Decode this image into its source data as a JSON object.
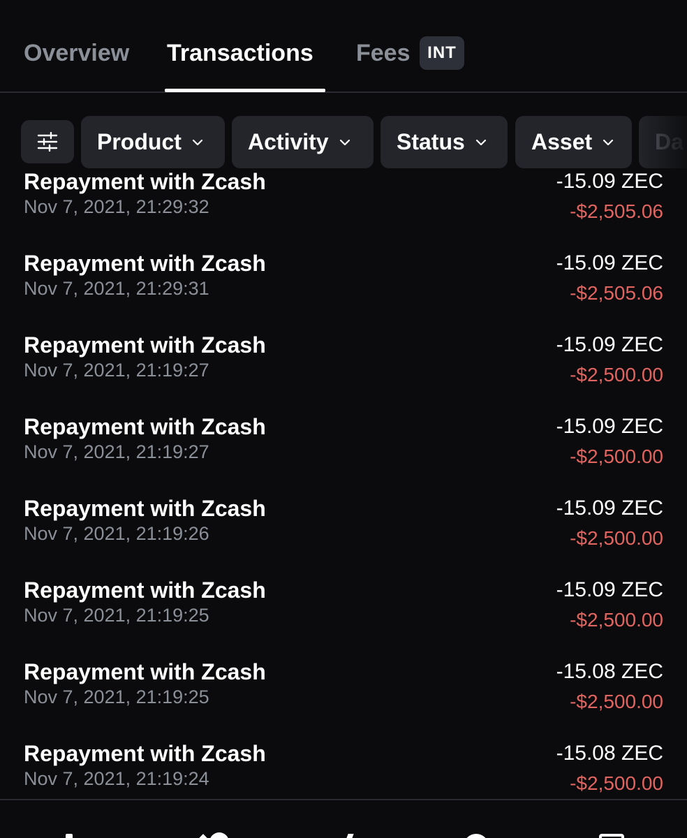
{
  "tabs": [
    {
      "label": "Overview",
      "active": false
    },
    {
      "label": "Transactions",
      "active": true
    },
    {
      "label": "Fees",
      "active": false,
      "badge": "INT"
    }
  ],
  "filters": {
    "chips": [
      {
        "label": "Product",
        "icon": "chevron-down-icon"
      },
      {
        "label": "Activity",
        "icon": "chevron-down-icon"
      },
      {
        "label": "Status",
        "icon": "chevron-down-icon"
      },
      {
        "label": "Asset",
        "icon": "chevron-down-icon"
      },
      {
        "label": "Da"
      }
    ],
    "filter_icon": "sliders-icon"
  },
  "transactions": [
    {
      "title": "Repayment with Zcash",
      "date": "Nov 7, 2021, 21:29:32",
      "amount": "-15.09 ZEC",
      "fiat": "-$2,505.06"
    },
    {
      "title": "Repayment with Zcash",
      "date": "Nov 7, 2021, 21:29:31",
      "amount": "-15.09 ZEC",
      "fiat": "-$2,505.06"
    },
    {
      "title": "Repayment with Zcash",
      "date": "Nov 7, 2021, 21:19:27",
      "amount": "-15.09 ZEC",
      "fiat": "-$2,500.00"
    },
    {
      "title": "Repayment with Zcash",
      "date": "Nov 7, 2021, 21:19:27",
      "amount": "-15.09 ZEC",
      "fiat": "-$2,500.00"
    },
    {
      "title": "Repayment with Zcash",
      "date": "Nov 7, 2021, 21:19:26",
      "amount": "-15.09 ZEC",
      "fiat": "-$2,500.00"
    },
    {
      "title": "Repayment with Zcash",
      "date": "Nov 7, 2021, 21:19:25",
      "amount": "-15.09 ZEC",
      "fiat": "-$2,500.00"
    },
    {
      "title": "Repayment with Zcash",
      "date": "Nov 7, 2021, 21:19:25",
      "amount": "-15.08 ZEC",
      "fiat": "-$2,500.00"
    },
    {
      "title": "Repayment with Zcash",
      "date": "Nov 7, 2021, 21:19:24",
      "amount": "-15.08 ZEC",
      "fiat": "-$2,500.00"
    }
  ],
  "colors": {
    "background": "#0b0b0d",
    "chip_background": "#23252b",
    "negative_fiat": "#e0645f",
    "muted_text": "#8a8f98"
  },
  "bottom_nav": [
    "home-icon",
    "trade-icon",
    "earn-icon",
    "pay-icon",
    "card-icon"
  ]
}
